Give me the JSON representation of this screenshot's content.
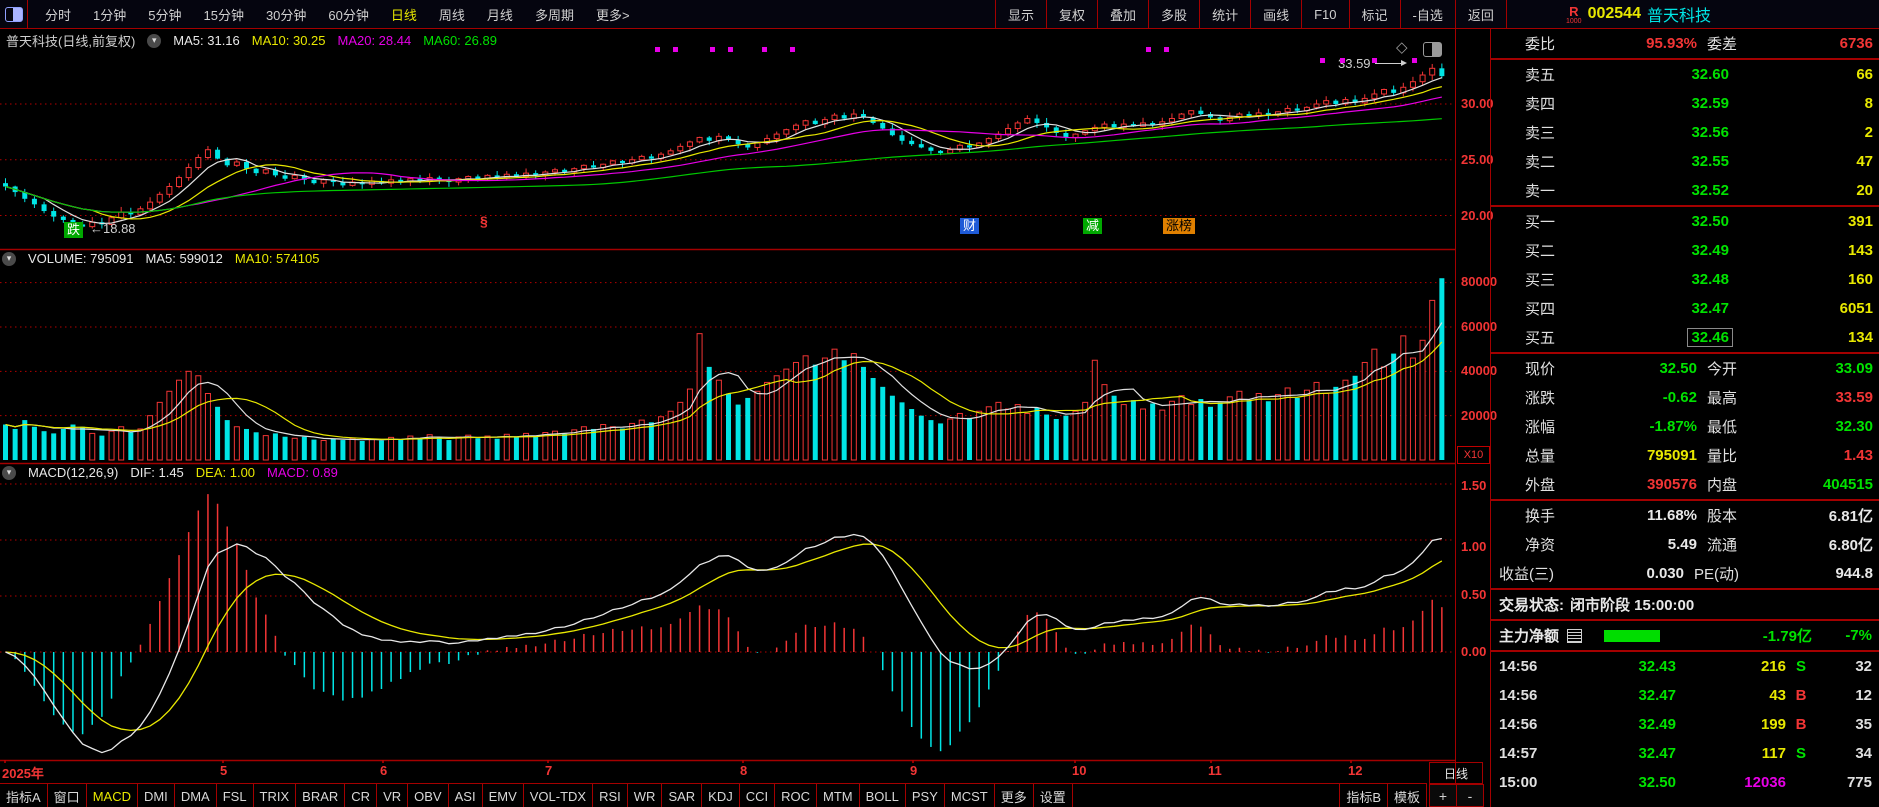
{
  "palette": {
    "red": "#f23535",
    "green": "#00e200",
    "yellow": "#e8e800",
    "cyan": "#00e5e5",
    "magenta": "#e600e6",
    "white": "#e8e8e8",
    "frame_red": "#a40000",
    "grid_red": "#c00000"
  },
  "toolbar": {
    "periods": [
      "分时",
      "1分钟",
      "5分钟",
      "15分钟",
      "30分钟",
      "60分钟",
      "日线",
      "周线",
      "月线",
      "多周期",
      "更多>"
    ],
    "active_period": "日线",
    "actions": [
      "显示",
      "复权",
      "叠加",
      "多股",
      "统计",
      "画线",
      "F10",
      "标记",
      "-自选",
      "返回"
    ]
  },
  "stock": {
    "flag": "R",
    "flag_sub": "1000",
    "code": "002544",
    "name": "普天科技"
  },
  "kpane": {
    "title": "普天科技(日线,前复权)",
    "ma5": "MA5: 31.16",
    "ma10": "MA10: 30.25",
    "ma20": "MA20: 28.44",
    "ma60": "MA60: 26.89",
    "annotations": {
      "low_badge": "跌",
      "low_text": "←18.88",
      "para_mark": "§",
      "badge_cai": "财",
      "badge_jian": "减",
      "badge_zhangbang": "涨榜",
      "high_text": "33.59"
    }
  },
  "volpane": {
    "vol": "VOLUME: 795091",
    "ma5": "MA5: 599012",
    "ma10": "MA10: 574105",
    "unit": "X10"
  },
  "macdpane": {
    "name": "MACD(12,26,9)",
    "dif": "DIF: 1.45",
    "dea": "DEA: 1.00",
    "macd": "MACD: 0.89"
  },
  "axis": {
    "price_labels": [
      "30.00",
      "25.00",
      "20.00"
    ],
    "vol_labels": [
      "80000",
      "60000",
      "40000",
      "20000"
    ],
    "macd_labels": [
      "1.50",
      "1.00",
      "0.50",
      "0.00"
    ],
    "period_box": "日线",
    "zoom_in": "+",
    "zoom_out": "-"
  },
  "tabbar": {
    "items": [
      "指标A",
      "窗口",
      "MACD",
      "DMI",
      "DMA",
      "FSL",
      "TRIX",
      "BRAR",
      "CR",
      "VR",
      "OBV",
      "ASI",
      "EMV",
      "VOL-TDX",
      "RSI",
      "WR",
      "SAR",
      "KDJ",
      "CCI",
      "ROC",
      "MTM",
      "BOLL",
      "PSY",
      "MCST",
      "更多",
      "设置"
    ],
    "active": "MACD",
    "right_items": [
      "指标B",
      "模板"
    ]
  },
  "sidebar": {
    "weibi": {
      "label": "委比",
      "value": "95.93%",
      "label2": "委差",
      "value2": "6736"
    },
    "sell": [
      {
        "label": "卖五",
        "price": "32.60",
        "qty": "66"
      },
      {
        "label": "卖四",
        "price": "32.59",
        "qty": "8"
      },
      {
        "label": "卖三",
        "price": "32.56",
        "qty": "2"
      },
      {
        "label": "卖二",
        "price": "32.55",
        "qty": "47"
      },
      {
        "label": "卖一",
        "price": "32.52",
        "qty": "20"
      }
    ],
    "buy": [
      {
        "label": "买一",
        "price": "32.50",
        "qty": "391"
      },
      {
        "label": "买二",
        "price": "32.49",
        "qty": "143"
      },
      {
        "label": "买三",
        "price": "32.48",
        "qty": "160"
      },
      {
        "label": "买四",
        "price": "32.47",
        "qty": "6051"
      },
      {
        "label": "买五",
        "price": "32.46",
        "qty": "134"
      }
    ],
    "details": [
      {
        "l1": "现价",
        "v1": "32.50",
        "l2": "今开",
        "v2": "33.09"
      },
      {
        "l1": "涨跌",
        "v1": "-0.62",
        "l2": "最高",
        "v2": "33.59"
      },
      {
        "l1": "涨幅",
        "v1": "-1.87%",
        "l2": "最低",
        "v2": "32.30"
      },
      {
        "l1": "总量",
        "v1": "795091",
        "l2": "量比",
        "v2": "1.43"
      },
      {
        "l1": "外盘",
        "v1": "390576",
        "l2": "内盘",
        "v2": "404515"
      }
    ],
    "info": [
      {
        "l1": "换手",
        "v1": "11.68%",
        "l2": "股本",
        "v2": "6.81亿"
      },
      {
        "l1": "净资",
        "v1": "5.49",
        "l2": "流通",
        "v2": "6.80亿"
      },
      {
        "l1": "收益(三)",
        "v1": "0.030",
        "l2": "PE(动)",
        "v2": "944.8"
      }
    ],
    "status_label": "交易状态:",
    "status_value": "闭市阶段 15:00:00",
    "mainforce": {
      "label": "主力净额",
      "amount": "-1.79亿",
      "pct": "-7%"
    },
    "ticks": [
      {
        "time": "14:56",
        "price": "32.43",
        "qty": "216",
        "side": "S",
        "count": "32"
      },
      {
        "time": "14:56",
        "price": "32.47",
        "qty": "43",
        "side": "B",
        "count": "12"
      },
      {
        "time": "14:56",
        "price": "32.49",
        "qty": "199",
        "side": "B",
        "count": "35"
      },
      {
        "time": "14:57",
        "price": "32.47",
        "qty": "117",
        "side": "S",
        "count": "34"
      },
      {
        "time": "15:00",
        "price": "32.50",
        "qty": "12036",
        "side": "",
        "count": "775"
      }
    ]
  },
  "chart_data": {
    "type": "candlestick",
    "title": "普天科技(日线,前复权)",
    "panes": [
      "price",
      "volume",
      "macd"
    ],
    "x_axis_labels": [
      "2025年",
      "5",
      "6",
      "7",
      "8",
      "9",
      "10",
      "11",
      "12"
    ],
    "month_tick_x": [
      2,
      220,
      380,
      545,
      740,
      910,
      1072,
      1208,
      1348
    ],
    "price": {
      "ylim": [
        17.2,
        35.4
      ],
      "gridlines": [
        30,
        25,
        20
      ],
      "ma_periods": [
        5,
        10,
        20,
        60
      ],
      "last_close": 32.5,
      "high": 33.59,
      "low": 18.88
    },
    "volume_axis": {
      "gridlines": [
        80000,
        60000,
        40000,
        20000
      ],
      "unit": "X10"
    },
    "macd": {
      "params": [
        12,
        26,
        9
      ],
      "gridlines": [
        1.5,
        1.0,
        0.5,
        0.0
      ],
      "dif": 1.45,
      "dea": 1.0,
      "hist": 0.89
    },
    "annotated_low": {
      "index": 8,
      "price": 18.88
    },
    "annotated_high": {
      "index": 148,
      "price": 33.59
    },
    "closes": [
      22.6,
      22.1,
      21.5,
      21.0,
      20.4,
      19.9,
      19.6,
      19.2,
      19.0,
      19.4,
      19.2,
      19.8,
      20.3,
      20.1,
      20.6,
      21.2,
      21.9,
      22.6,
      23.4,
      24.3,
      25.2,
      25.9,
      25.1,
      24.5,
      24.8,
      24.2,
      23.8,
      24.1,
      23.6,
      23.3,
      23.6,
      23.2,
      22.9,
      23.2,
      23.0,
      22.7,
      23.0,
      22.8,
      23.1,
      22.9,
      23.2,
      23.0,
      23.3,
      23.1,
      23.4,
      23.2,
      23.0,
      23.3,
      23.5,
      23.3,
      23.6,
      23.4,
      23.7,
      23.5,
      23.8,
      23.6,
      23.9,
      24.1,
      23.9,
      24.2,
      24.5,
      24.3,
      24.6,
      24.9,
      24.7,
      25.0,
      25.3,
      25.1,
      25.5,
      25.8,
      26.2,
      26.6,
      27.0,
      26.7,
      27.1,
      26.8,
      26.4,
      26.1,
      26.5,
      26.9,
      27.3,
      27.7,
      28.1,
      28.5,
      28.2,
      28.6,
      29.0,
      28.7,
      29.1,
      28.8,
      28.3,
      27.8,
      27.2,
      26.7,
      26.4,
      26.1,
      25.8,
      25.6,
      25.9,
      26.3,
      26.1,
      26.5,
      26.9,
      27.3,
      27.8,
      28.3,
      28.7,
      28.3,
      27.9,
      27.4,
      27.0,
      27.3,
      27.6,
      27.9,
      28.2,
      27.9,
      28.2,
      28.0,
      28.3,
      28.1,
      28.4,
      28.7,
      29.1,
      29.4,
      29.1,
      28.8,
      28.5,
      28.8,
      29.1,
      28.9,
      29.2,
      29.0,
      29.3,
      29.6,
      29.4,
      29.7,
      30.0,
      30.3,
      30.0,
      30.4,
      30.1,
      30.5,
      30.9,
      31.3,
      31.0,
      31.5,
      32.0,
      32.6,
      33.2,
      32.5
    ],
    "volumes": [
      16000,
      14000,
      18000,
      15000,
      13000,
      12000,
      14000,
      16000,
      15000,
      12000,
      11000,
      13000,
      15000,
      12500,
      14000,
      20000,
      26000,
      31000,
      36000,
      40000,
      38000,
      30000,
      24000,
      18000,
      15000,
      14000,
      12500,
      11000,
      12000,
      10500,
      9800,
      10500,
      9200,
      8800,
      9600,
      9000,
      9800,
      8600,
      9400,
      8800,
      10200,
      9400,
      10800,
      9800,
      11400,
      10200,
      9000,
      10400,
      11200,
      9800,
      10800,
      9600,
      11600,
      10400,
      12000,
      10800,
      12400,
      13000,
      11800,
      13600,
      15000,
      14000,
      16000,
      15000,
      14200,
      16500,
      18000,
      17000,
      19500,
      22000,
      26000,
      32000,
      57000,
      42000,
      36000,
      30000,
      25000,
      28000,
      31000,
      35000,
      38000,
      41000,
      44000,
      47000,
      43000,
      46000,
      50000,
      45000,
      48000,
      42000,
      37000,
      33000,
      29000,
      26000,
      23000,
      20000,
      18000,
      16500,
      18500,
      21000,
      19000,
      22000,
      24000,
      26000,
      23000,
      25000,
      21000,
      23500,
      20500,
      18500,
      20000,
      22000,
      26000,
      45000,
      34000,
      29000,
      25000,
      27000,
      23000,
      25500,
      22500,
      26500,
      29000,
      25000,
      27500,
      24000,
      26000,
      28500,
      31000,
      27000,
      30000,
      26500,
      29500,
      32500,
      28000,
      31500,
      35000,
      30000,
      33000,
      36000,
      38000,
      44000,
      50000,
      42000,
      48000,
      56000,
      46000,
      54000,
      72000,
      82000
    ]
  }
}
